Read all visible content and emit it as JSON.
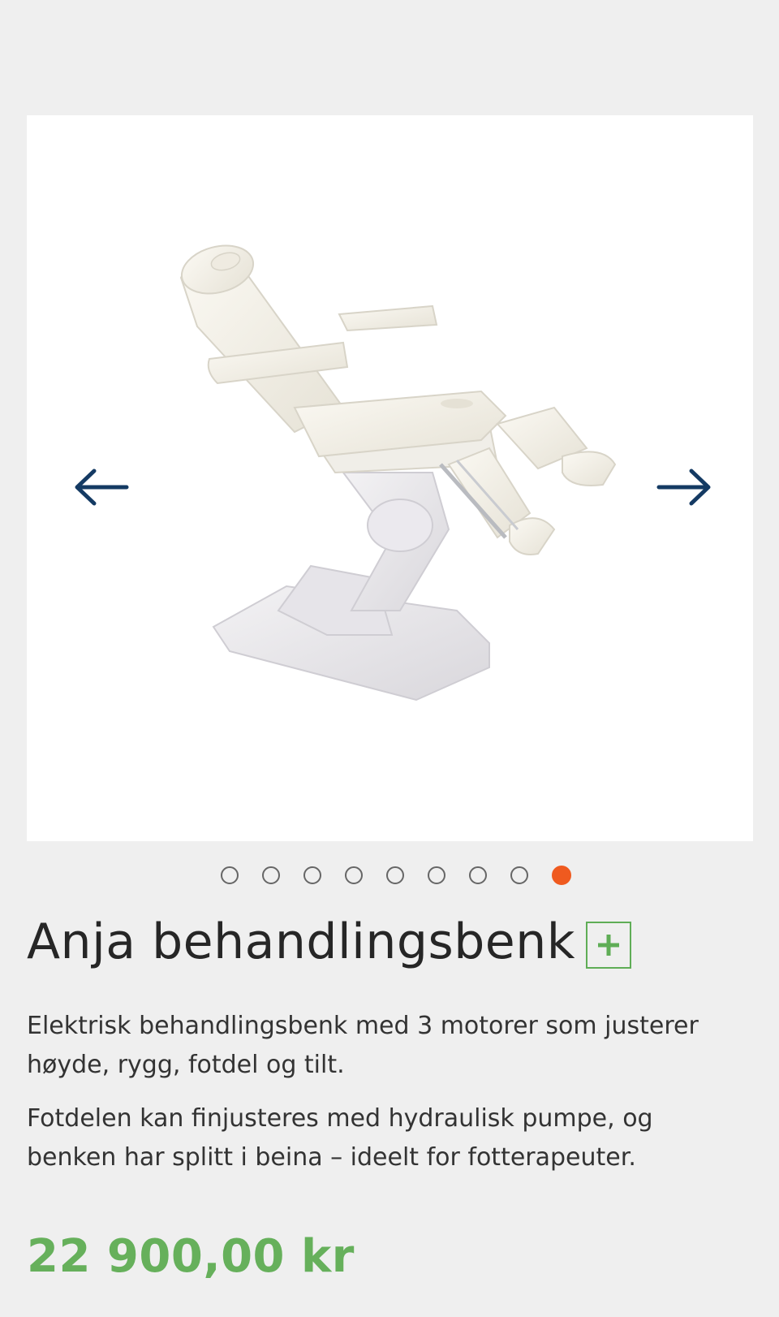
{
  "gallery": {
    "image_alt": "Anja behandlingsbenk",
    "prev_icon": "arrow-left-icon",
    "next_icon": "arrow-right-icon",
    "slide_count": 9,
    "active_slide": 9
  },
  "product": {
    "title": "Anja behandlingsbenk",
    "badge_icon": "plus-icon",
    "description": [
      "Elektrisk behandlingsbenk med 3 motorer som justerer høyde, rygg, fotdel og tilt.",
      "Fotdelen kan finjusteres med hydraulisk pumpe, og benken har splitt i beina – ideelt for fotterapeuter."
    ],
    "price": "22 900,00 kr"
  },
  "colors": {
    "background": "#efefef",
    "arrow": "#143a63",
    "dot_active": "#ef5a1f",
    "price": "#66b05b",
    "badge": "#5fad56"
  }
}
